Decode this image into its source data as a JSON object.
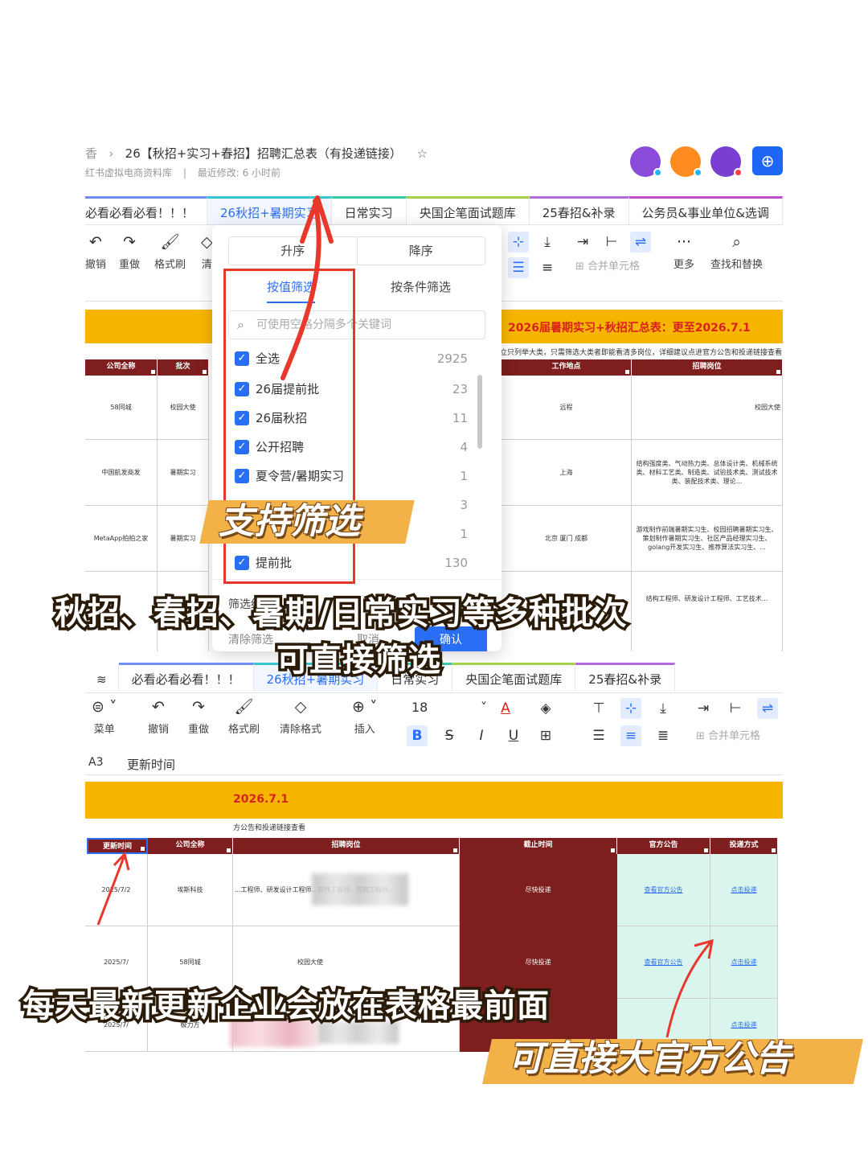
{
  "header": {
    "breadcrumb_prefix": "香",
    "doc_title": "26【秋招+实习+春招】招聘汇总表（有投递链接）",
    "library": "红书虚拟电商资料库",
    "last_modified": "最近修改: 6 小时前",
    "separator": "|"
  },
  "avatars": [
    {
      "name": "avatar-purple",
      "color": "#8a4bd9",
      "dot": "#1fb6ff"
    },
    {
      "name": "avatar-orange",
      "color": "#ff8a1f",
      "dot": "#1fb6ff"
    },
    {
      "name": "avatar-violet",
      "color": "#7a3fd1",
      "dot": "#ff3b4a"
    }
  ],
  "tabs_top": [
    {
      "label": "必看必看必看！！！",
      "color": "#6f8df5",
      "active": false
    },
    {
      "label": "26秋招+暑期实习",
      "color": "#38c6d1",
      "active": true
    },
    {
      "label": "日常实习",
      "color": "#38c9a8",
      "active": false
    },
    {
      "label": "央国企笔面试题库",
      "color": "#a6d14b",
      "active": false
    },
    {
      "label": "25春招&补录",
      "color": "#b56be0",
      "active": false
    },
    {
      "label": "公务员&事业单位&选调",
      "color": "#c24bd0",
      "active": false
    }
  ],
  "toolbar_top": {
    "undo": "撤销",
    "redo": "重做",
    "format_painter": "格式刷",
    "clear": "清",
    "merge_cells": "合并单元格",
    "more": "更多",
    "find_replace": "查找和替换"
  },
  "sheet_top": {
    "banner_title": "2026届暑期实习+秋招汇总表：更至2026.7.1",
    "notice": "立只列举大类，只需筛选大类者即能看清多岗位，详细建议点进官方公告和投递链接查看",
    "headers": [
      "公司全称",
      "批次",
      "工作地点",
      "招聘岗位"
    ],
    "rows": [
      {
        "company": "58同城",
        "batch": "校园大使",
        "location": "远程",
        "position": "校园大使"
      },
      {
        "company": "中国航发商发",
        "batch": "暑期实习",
        "location": "上海",
        "position": "结构强度类、气动热力类、总体设计类、机械系统类、材料工艺类、制造类、试验技术类、测试技术类、装配技术类、理论..."
      },
      {
        "company": "MetaApp拍拍之家",
        "batch": "暑期实习",
        "location": "北京 厦门 成都",
        "position": "游戏制作前端暑期实习生、校园招聘暑期实习生、策划制作暑期实习生、社区产品经理实习生、golang开发实习生、推荐算法实习生、..."
      },
      {
        "company": "",
        "batch": "",
        "location": "",
        "position": "结构工程师、研发设计工程师、工艺技术..."
      }
    ]
  },
  "filter_popup": {
    "sort_asc": "升序",
    "sort_desc": "降序",
    "tab_by_value": "按值筛选",
    "tab_by_condition": "按条件筛选",
    "search_placeholder": "可使用空格分隔多个关键词",
    "options": [
      {
        "label": "全选",
        "count": "2925",
        "checked": true
      },
      {
        "label": "26届提前批",
        "count": "23",
        "checked": true
      },
      {
        "label": "26届秋招",
        "count": "11",
        "checked": true
      },
      {
        "label": "公开招聘",
        "count": "4",
        "checked": true
      },
      {
        "label": "夏令营/暑期实习",
        "count": "1",
        "checked": true
      },
      {
        "label": "",
        "count": "3",
        "checked": false
      },
      {
        "label": "",
        "count": "1",
        "checked": false
      },
      {
        "label": "提前批",
        "count": "130",
        "checked": true
      }
    ],
    "result_label": "筛选结果",
    "clear_filter": "清除筛选",
    "cancel": "取消",
    "confirm": "确认"
  },
  "tabs_bottom": [
    {
      "label": "必看必看必看！！！",
      "color": "#6f8df5",
      "active": false
    },
    {
      "label": "26秋招+暑期实习",
      "color": "#38c6d1",
      "active": true
    },
    {
      "label": "日常实习",
      "color": "#38c9a8",
      "active": false
    },
    {
      "label": "央国企笔面试题库",
      "color": "#a6d14b",
      "active": false
    },
    {
      "label": "25春招&补录",
      "color": "#b56be0",
      "active": false
    }
  ],
  "toolbar_bottom": {
    "menu": "菜单",
    "undo": "撤销",
    "redo": "重做",
    "format_painter": "格式刷",
    "clear_format": "清除格式",
    "insert": "插入",
    "font_size": "18",
    "merge_cells": "合并单元格",
    "bold": "B",
    "strike": "S",
    "italic": "I",
    "underline": "U",
    "font_color_glyph": "A"
  },
  "formula_bar": {
    "cell_ref": "A3",
    "content": "更新时间"
  },
  "sheet_bottom": {
    "banner_title": "2026.7.1",
    "notice": "方公告和投递链接查看",
    "headers": [
      "更新时间",
      "公司全称",
      "招聘岗位",
      "截止时间",
      "官方公告",
      "投递方式"
    ],
    "rows": [
      {
        "date": "2025/7/2",
        "company": "埃斯科技",
        "position": "...工程师、研发设计工程师...软件工程师...控制工程师...",
        "deadline": "尽快投递",
        "notice": "查看官方公告",
        "apply": "点击投递"
      },
      {
        "date": "2025/7/",
        "company": "58同城",
        "position": "校园大使",
        "deadline": "尽快投递",
        "notice": "查看官方公告",
        "apply": "点击投递"
      },
      {
        "date": "2025/7/",
        "company": "极力方",
        "position": "",
        "deadline": "",
        "notice": "",
        "apply": "点击投递"
      }
    ]
  },
  "captions": {
    "support_filter": "支持筛选",
    "batches_line1": "秋招、春招、暑期/日常实习等多种批次",
    "batches_line2": "可直接筛选",
    "daily_update": "每天最新更新企业会放在表格最前面",
    "official": "可直接大官方公告"
  },
  "colors": {
    "accent_blue": "#2a6ef5",
    "banner_yellow": "#f7b500",
    "header_maroon": "#7e1e1e",
    "highlight_red": "#e8382c",
    "tag_orange": "#f2b248",
    "mint": "#d9f5ee"
  }
}
